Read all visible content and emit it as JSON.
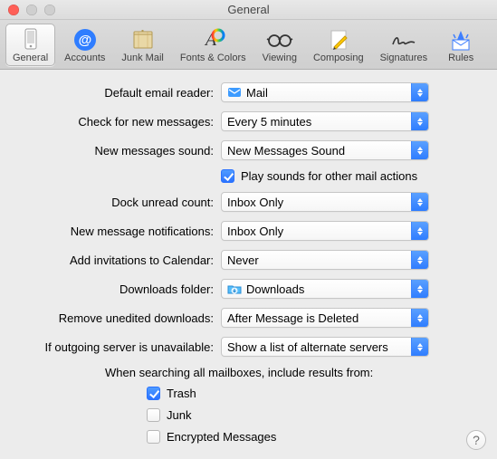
{
  "window": {
    "title": "General"
  },
  "toolbar": {
    "items": [
      {
        "label": "General"
      },
      {
        "label": "Accounts"
      },
      {
        "label": "Junk Mail"
      },
      {
        "label": "Fonts & Colors"
      },
      {
        "label": "Viewing"
      },
      {
        "label": "Composing"
      },
      {
        "label": "Signatures"
      },
      {
        "label": "Rules"
      }
    ]
  },
  "form": {
    "default_reader": {
      "label": "Default email reader:",
      "value": "Mail"
    },
    "check_messages": {
      "label": "Check for new messages:",
      "value": "Every 5 minutes"
    },
    "new_sound": {
      "label": "New messages sound:",
      "value": "New Messages Sound"
    },
    "play_sounds": {
      "label": "Play sounds for other mail actions",
      "checked": true
    },
    "dock_unread": {
      "label": "Dock unread count:",
      "value": "Inbox Only"
    },
    "notifications": {
      "label": "New message notifications:",
      "value": "Inbox Only"
    },
    "invitations": {
      "label": "Add invitations to Calendar:",
      "value": "Never"
    },
    "downloads": {
      "label": "Downloads folder:",
      "value": "Downloads"
    },
    "remove_downloads": {
      "label": "Remove unedited downloads:",
      "value": "After Message is Deleted"
    },
    "outgoing": {
      "label": "If outgoing server is unavailable:",
      "value": "Show a list of alternate servers"
    }
  },
  "search": {
    "heading": "When searching all mailboxes, include results from:",
    "trash": {
      "label": "Trash",
      "checked": true
    },
    "junk": {
      "label": "Junk",
      "checked": false
    },
    "encrypted": {
      "label": "Encrypted Messages",
      "checked": false
    }
  },
  "help": {
    "symbol": "?"
  }
}
